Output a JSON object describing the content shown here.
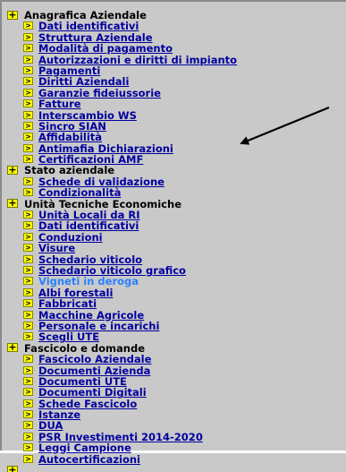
{
  "menu": {
    "sections": [
      {
        "label": "Anagrafica Aziendale",
        "items": [
          {
            "label": "Dati identificativi"
          },
          {
            "label": "Struttura Aziendale"
          },
          {
            "label": "Modalità di pagamento"
          },
          {
            "label": "Autorizzazioni e diritti di impianto"
          },
          {
            "label": "Pagamenti"
          },
          {
            "label": "Diritti Aziendali"
          },
          {
            "label": "Garanzie fideiussorie"
          },
          {
            "label": "Fatture"
          },
          {
            "label": "Interscambio WS"
          },
          {
            "label": "Sincro SIAN"
          },
          {
            "label": "Affidabilità"
          },
          {
            "label": "Antimafia Dichiarazioni"
          },
          {
            "label": "Certificazioni AMF"
          }
        ]
      },
      {
        "label": "Stato aziendale",
        "items": [
          {
            "label": "Schede di validazione"
          },
          {
            "label": "Condizionalità"
          }
        ]
      },
      {
        "label": "Unità Tecniche Economiche",
        "items": [
          {
            "label": "Unità Locali da RI"
          },
          {
            "label": "Dati identificativi"
          },
          {
            "label": "Conduzioni"
          },
          {
            "label": "Visure"
          },
          {
            "label": "Schedario viticolo"
          },
          {
            "label": "Schedario viticolo grafico"
          },
          {
            "label": "Vigneti in deroga",
            "active": true
          },
          {
            "label": "Albi forestali"
          },
          {
            "label": "Fabbricati"
          },
          {
            "label": "Macchine Agricole"
          },
          {
            "label": "Personale e incarichi"
          },
          {
            "label": "Scegli UTE"
          }
        ]
      },
      {
        "label": "Fascicolo e domande",
        "items": [
          {
            "label": "Fascicolo Aziendale"
          },
          {
            "label": "Documenti Azienda"
          },
          {
            "label": "Documenti UTE"
          },
          {
            "label": "Documenti Digitali"
          },
          {
            "label": "Schede Fascicolo"
          },
          {
            "label": "Istanze"
          },
          {
            "label": "DUA"
          },
          {
            "label": "PSR Investimenti 2014-2020"
          },
          {
            "label": "Leggi Campione"
          },
          {
            "label": "Autocertificazioni"
          }
        ]
      }
    ],
    "section_icon": "+",
    "item_icon": ">"
  },
  "icons": {
    "section": "expand-plus-icon",
    "item": "arrow-right-icon"
  },
  "colors": {
    "background": "#c9c9c9",
    "link": "#0000a0",
    "active_link": "#2a7fff",
    "icon_fill": "#ffff00"
  }
}
